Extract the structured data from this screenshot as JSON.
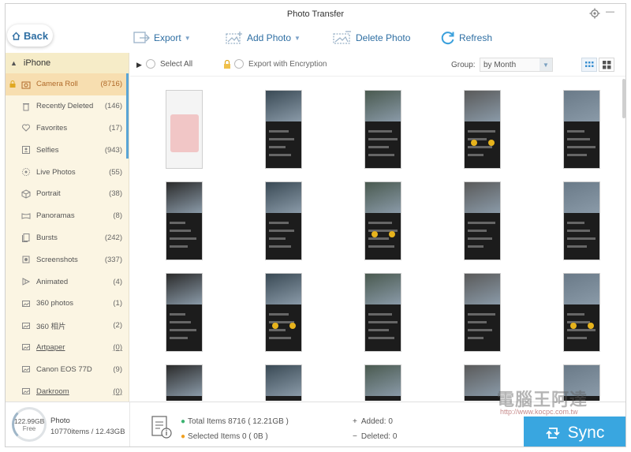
{
  "window": {
    "title": "Photo Transfer"
  },
  "toolbar": {
    "back_label": "Back",
    "export_label": "Export",
    "add_photo_label": "Add Photo",
    "delete_photo_label": "Delete Photo",
    "refresh_label": "Refresh"
  },
  "sidebar": {
    "device": "iPhone",
    "items": [
      {
        "label": "Camera Roll",
        "count": "(8716)",
        "icon": "camera-icon"
      },
      {
        "label": "Recently Deleted",
        "count": "(146)",
        "icon": "trash-icon"
      },
      {
        "label": "Favorites",
        "count": "(17)",
        "icon": "heart-icon"
      },
      {
        "label": "Selfies",
        "count": "(943)",
        "icon": "selfie-icon"
      },
      {
        "label": "Live Photos",
        "count": "(55)",
        "icon": "live-photo-icon"
      },
      {
        "label": "Portrait",
        "count": "(38)",
        "icon": "cube-icon"
      },
      {
        "label": "Panoramas",
        "count": "(8)",
        "icon": "panorama-icon"
      },
      {
        "label": "Bursts",
        "count": "(242)",
        "icon": "bursts-icon"
      },
      {
        "label": "Screenshots",
        "count": "(337)",
        "icon": "screenshot-icon"
      },
      {
        "label": "Animated",
        "count": "(4)",
        "icon": "animated-icon"
      },
      {
        "label": "360 photos",
        "count": "(1)",
        "icon": "album-icon"
      },
      {
        "label": "360 相片",
        "count": "(2)",
        "icon": "album-icon"
      },
      {
        "label": "Artpaper",
        "count": "(0)",
        "icon": "album-icon"
      },
      {
        "label": "Canon EOS 77D",
        "count": "(9)",
        "icon": "album-icon"
      },
      {
        "label": "Darkroom",
        "count": "(0)",
        "icon": "album-icon"
      }
    ]
  },
  "content": {
    "select_all_label": "Select All",
    "encryption_label": "Export with Encryption",
    "group_label": "Group:",
    "group_value": "by Month"
  },
  "bottom": {
    "storage_free": "122.99GB",
    "storage_label": "Free",
    "phone_label": "Photo",
    "phone_info": "10770items / 12.43GB",
    "total_items": "Total Items 8716 ( 12.21GB )",
    "selected_items": "Selected Items 0 ( 0B )",
    "added": "Added: 0",
    "deleted": "Deleted: 0",
    "sync_label": "Sync"
  },
  "watermark": {
    "text": "電腦王阿達",
    "url": "http://www.kocpc.com.tw"
  },
  "colors": {
    "accent": "#39a6e0",
    "sidebar_bg": "#fbf5e3",
    "selected_bg": "#f7deb0",
    "link": "#2f6fa3"
  }
}
